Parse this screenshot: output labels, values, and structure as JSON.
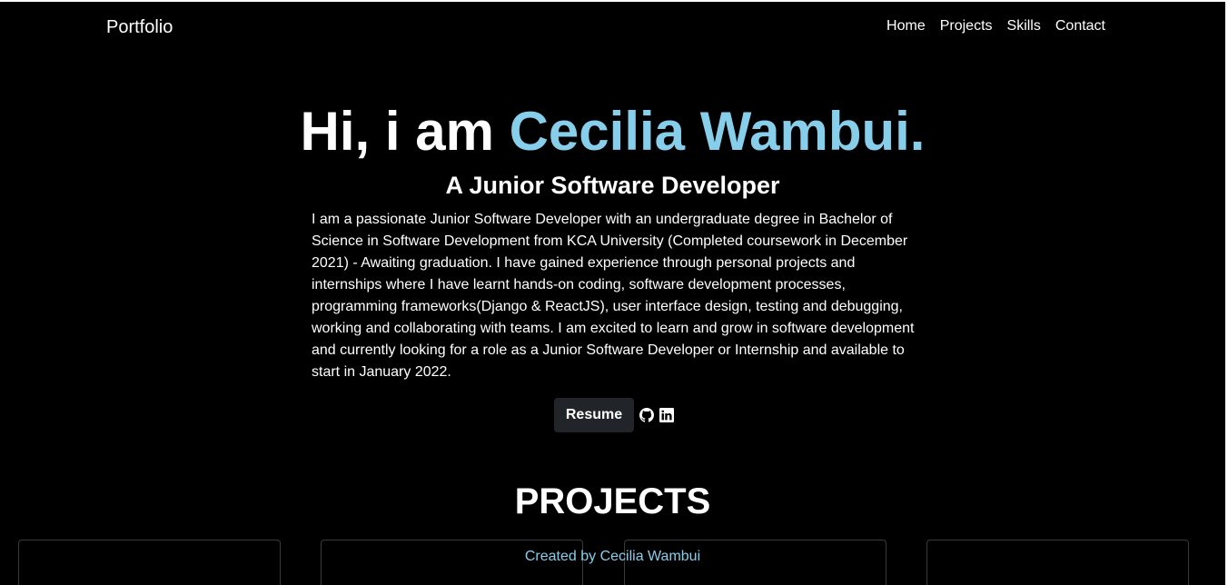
{
  "navbar": {
    "brand": "Portfolio",
    "links": [
      "Home",
      "Projects",
      "Skills",
      "Contact"
    ]
  },
  "hero": {
    "greeting": "Hi, i am ",
    "name": "Cecilia Wambui.",
    "subtitle": "A Junior Software Developer",
    "bio": "I am a passionate Junior Software Developer with an undergraduate degree in Bachelor of Science in Software Development from KCA University (Completed coursework in December 2021) - Awaiting graduation. I have gained experience through personal projects and internships where I have learnt hands-on coding, software development processes, programming frameworks(Django & ReactJS), user interface design, testing and debugging, working and collaborating with teams. I am excited to learn and grow in software development and currently looking for a role as a Junior Software Developer or Internship and available to start in January 2022.",
    "resume_label": "Resume",
    "icons": [
      "github-icon",
      "linkedin-icon"
    ]
  },
  "projects": {
    "heading": "PROJECTS"
  },
  "footer": {
    "text": "Created by Cecilia Wambui"
  },
  "colors": {
    "background": "#000000",
    "accent": "#87ceeb",
    "button": "#212529",
    "text": "#ffffff"
  }
}
